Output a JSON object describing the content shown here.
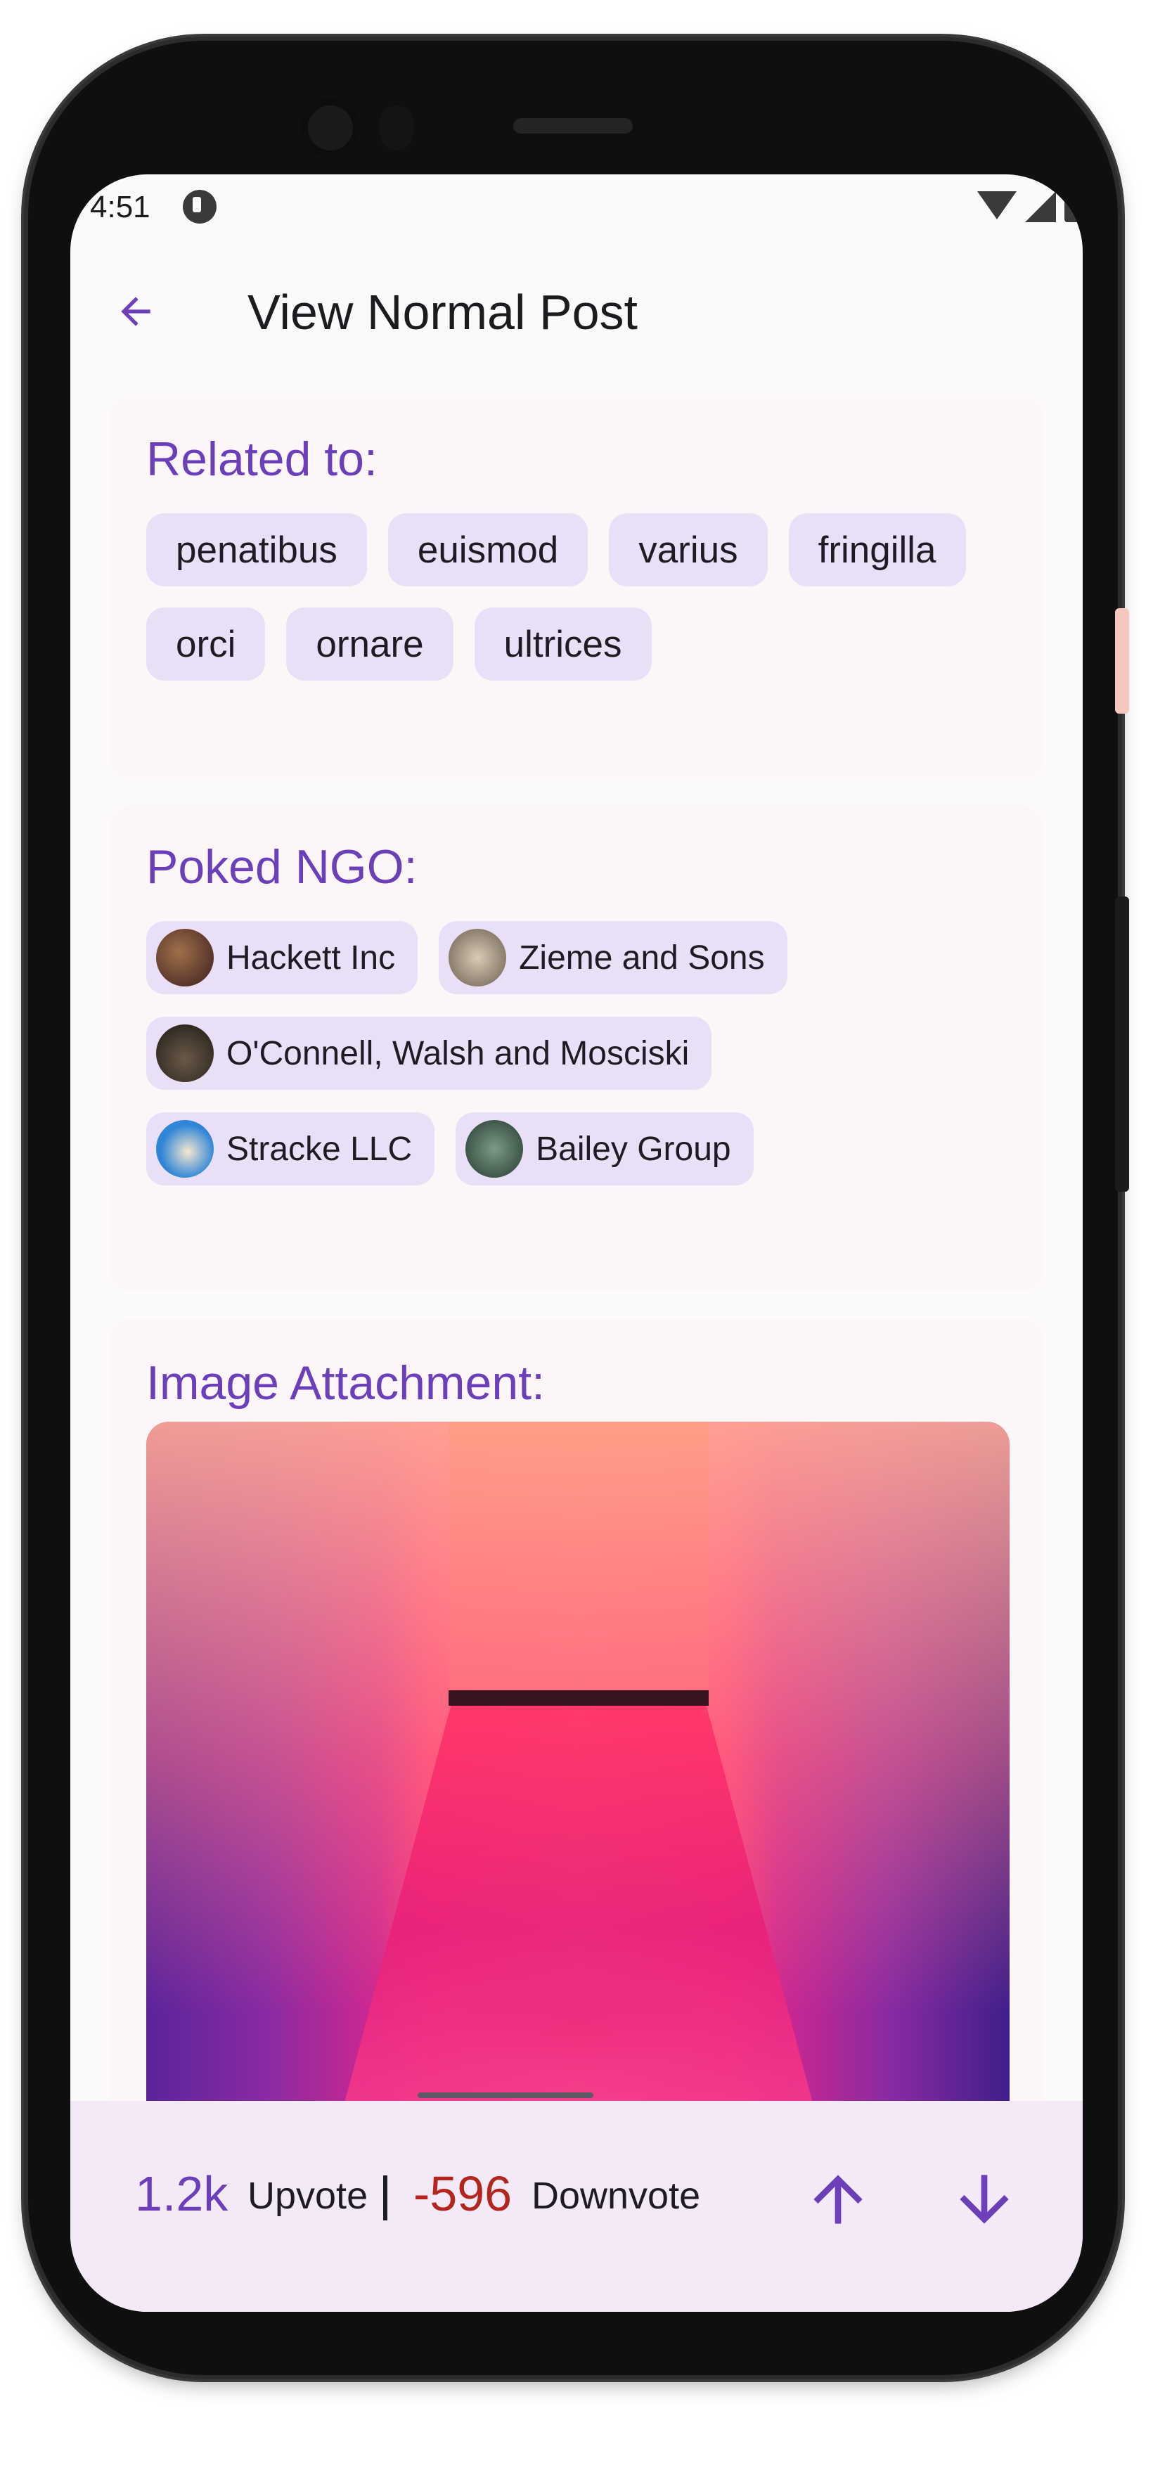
{
  "status_bar": {
    "time": "4:51",
    "icons": [
      "app-notification-icon",
      "wifi-icon",
      "signal-icon",
      "battery-icon"
    ]
  },
  "app_bar": {
    "title": "View Normal Post",
    "back_icon": "arrow-back-icon"
  },
  "related": {
    "title": "Related to:",
    "tags": [
      "penatibus",
      "euismod",
      "varius",
      "fringilla",
      "orci",
      "ornare",
      "ultrices"
    ]
  },
  "ngo": {
    "title": "Poked NGO:",
    "items": [
      {
        "name": "Hackett Inc",
        "avatar_color": "#5a2a2a"
      },
      {
        "name": "Zieme and Sons",
        "avatar_color": "#8a7a66"
      },
      {
        "name": "O'Connell, Walsh and Mosciski",
        "avatar_color": "#2b2622"
      },
      {
        "name": "Stracke LLC",
        "avatar_color": "#2f86d6"
      },
      {
        "name": "Bailey Group",
        "avatar_color": "#3d5a4a"
      }
    ]
  },
  "attachment": {
    "title": "Image Attachment:"
  },
  "votes": {
    "upvote_count": "1.2k",
    "upvote_label": "Upvote",
    "downvote_count": "-596",
    "downvote_label": "Downvote",
    "upvote_icon": "arrow-up-icon",
    "downvote_icon": "arrow-down-icon"
  },
  "colors": {
    "accent": "#6a3fb9",
    "negative": "#b3261e",
    "chip_background": "#e9dff6",
    "bottom_bar": "#f3e9f7"
  }
}
